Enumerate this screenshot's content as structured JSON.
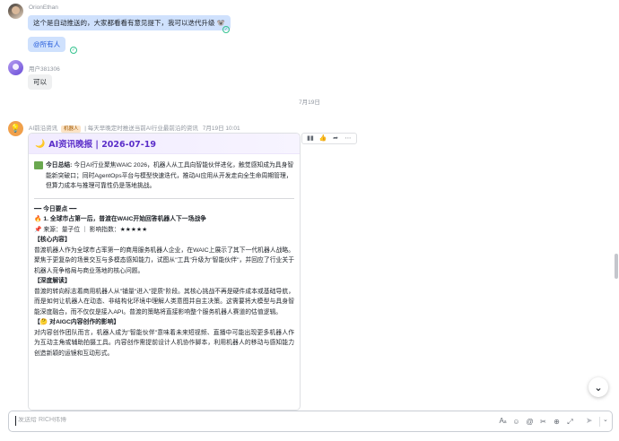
{
  "messages": {
    "orion": {
      "sender": "OrionEthan",
      "text1": "这个是自动推送的，大家都看看有意见提下，我可以迭代升级 🐨",
      "mention": "@所有人"
    },
    "user": {
      "sender": "用户381306",
      "text": "可以"
    },
    "date_divider": "7月19日",
    "bot": {
      "sender": "AI前沿资讯",
      "tag": "机器人",
      "desc": "| 每天早晚定时推送当前AI行业最前沿的资讯",
      "time": "7月19日 10:01"
    }
  },
  "card": {
    "title": "AI资讯晚报 | 2026-07-19",
    "summary_label": "今日总结:",
    "summary_text": "今日AI行业聚焦WAIC 2026，机器人从工具向智能伙伴进化，触觉感知成为具身智能新突破口；同时AgentOps平台与模型快速迭代，推动AI应用从开发走向全生命周期管理，但算力成本与推理可靠性仍是落地挑战。",
    "section_heading": "━━ 今日要点 ━━",
    "news_title": "🔥 1. 全球市占第一后，普渡在WAIC开始回答机器人下一场战争",
    "news_meta": "📌 来源：量子位 ｜ 影响指数：★★★★★",
    "core_title": "【核心内容】",
    "core_text": "普渡机器人作为全球市占率第一的商用服务机器人企业，在WAIC上展示了其下一代机器人战略。聚焦于更复杂的场景交互与多模态感知能力，试图从\"工具\"升级为\"智能伙伴\"，并回应了行业关于机器人竞争格局与商业落地的核心问题。",
    "deep_title": "【深度解读】",
    "deep_text": "普渡的转向标志着商用机器人从\"铺量\"进入\"提质\"阶段。其核心挑战不再是硬件成本或基础导航，而是如何让机器人在动态、非结构化环境中理解人类意图并自主决策。这需要将大模型与具身智能深度融合，而不仅仅是接入API。普渡的策略将直接影响整个服务机器人赛道的估值逻辑。",
    "aigc_title": "【🤔 对AIGC内容创作的影响】",
    "aigc_text": "对内容创作团队而言，机器人成为\"智能伙伴\"意味着未来短视频、直播中可能出现更多机器人作为互动主角或辅助拍摄工具。内容创作需提前设计人机协作脚本，利用机器人的移动与感知能力创造新颖的运镜和互动形式。"
  },
  "toolbar_icons": [
    "stats-icon",
    "thumbs-up-icon",
    "forward-icon",
    "more-icon"
  ],
  "composer": {
    "placeholder": "发送给 RICH纬博"
  },
  "colors": {
    "card_title": "#5b2ec9",
    "bubble_blue": "#cfe1fd",
    "bubble_grey": "#eff0f1",
    "bot_tag_bg": "#fbe3c6"
  }
}
